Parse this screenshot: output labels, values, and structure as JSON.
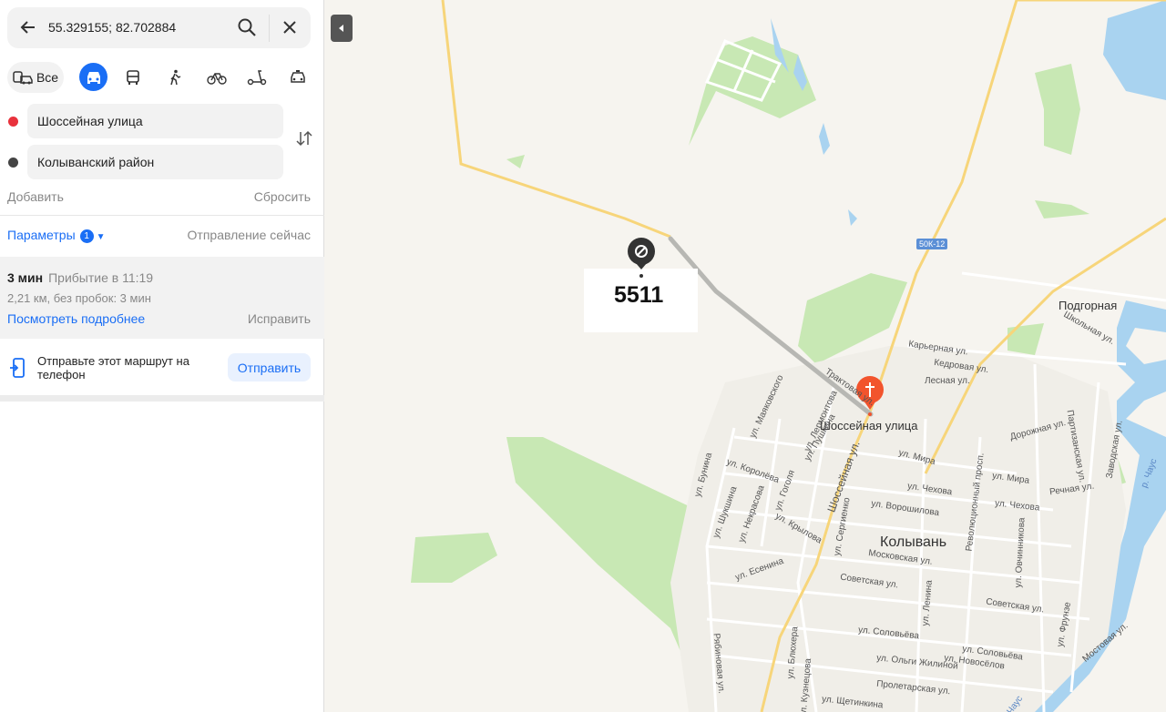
{
  "search": {
    "query": "55.329155; 82.702884"
  },
  "modes": {
    "all_label": "Все"
  },
  "route_points": {
    "from": "Шоссейная улица",
    "to": "Колыванский район",
    "add_label": "Добавить",
    "reset_label": "Сбросить"
  },
  "params": {
    "label": "Параметры",
    "count": "1",
    "departure": "Отправление сейчас"
  },
  "route": {
    "duration": "3 мин",
    "arrival": "Прибытие в 11:19",
    "details": "2,21 км, без пробок: 3 мин",
    "more_label": "Посмотреть подробнее",
    "fix_label": "Исправить"
  },
  "send": {
    "text": "Отправьте этот маршрут на телефон",
    "button": "Отправить"
  },
  "map": {
    "road_badge": "50К-12",
    "overlay_number": "5511",
    "destination_label": "Шоссейная улица",
    "town": "Колывань",
    "village": "Подгорная",
    "streets": [
      "Карьерная ул.",
      "Кедровая ул.",
      "Лесная ул.",
      "ул. Мира",
      "ул. Чехова",
      "ул. Ворошилова",
      "Московская ул.",
      "Советская ул.",
      "ул. Соловьёва",
      "ул. Ольги Жилиной",
      "Пролетарская ул.",
      "ул. Щетинкина",
      "Речная ул.",
      "Дорожная ул.",
      "Школьная ул.",
      "Партизанская ул.",
      "Заводская ул.",
      "Революционный просп.",
      "Шоссейная ул.",
      "ул. Бунина",
      "ул. Королёва",
      "ул. Шукшина",
      "ул. Некрасова",
      "ул. Есенина",
      "ул. Крылова",
      "ул. Гоголя",
      "ул. Сергиенко",
      "ул. Ленина",
      "ул. Фрунзе",
      "Мостовая ул.",
      "ул. Новосёлов",
      "ул. Блюхера",
      "ул. Кузнецова",
      "ул. Маяковского",
      "ул. Лермонтова",
      "ул. Пушкина",
      "Рябиновая ул.",
      "ул. Овчинникова",
      "Трактовая ул.",
      "р. Чаус",
      "Чаус",
      "ул. Мира",
      "ул. Чехова",
      "Советская ул.",
      "ул. Соловьёва"
    ]
  },
  "colors": {
    "accent": "#1a6ef5",
    "water": "#a9d3f0",
    "forest": "#c8e8b4",
    "road_major": "#f7d57a",
    "pin": "#f2542d"
  }
}
